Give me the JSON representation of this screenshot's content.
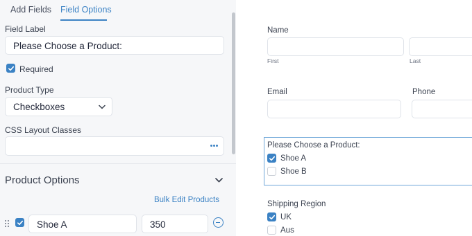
{
  "tabs": [
    {
      "label": "Add Fields",
      "active": false
    },
    {
      "label": "Field Options",
      "active": true
    }
  ],
  "field_options": {
    "field_label_heading": "Field Label",
    "field_label_value": "Please Choose a Product:",
    "required_label": "Required",
    "required_checked": true,
    "product_type_heading": "Product Type",
    "product_type_value": "Checkboxes",
    "css_classes_heading": "CSS Layout Classes",
    "css_classes_value": ""
  },
  "product_options": {
    "title": "Product Options",
    "bulk_edit_label": "Bulk Edit Products",
    "items": [
      {
        "name": "Shoe A",
        "price": "350",
        "checked": true
      }
    ]
  },
  "form_preview": {
    "name_label": "Name",
    "first_label": "First",
    "last_label": "Last",
    "email_label": "Email",
    "phone_label": "Phone",
    "product_question": "Please Choose a Product:",
    "products": [
      {
        "label": "Shoe A",
        "checked": true
      },
      {
        "label": "Shoe B",
        "checked": false
      }
    ],
    "shipping_label": "Shipping Region",
    "regions": [
      {
        "label": "UK",
        "checked": true
      },
      {
        "label": "Aus",
        "checked": false
      }
    ]
  },
  "colors": {
    "accent": "#3b82c4",
    "panel_bg": "#f6f7f9",
    "border": "#dfe3e9"
  }
}
